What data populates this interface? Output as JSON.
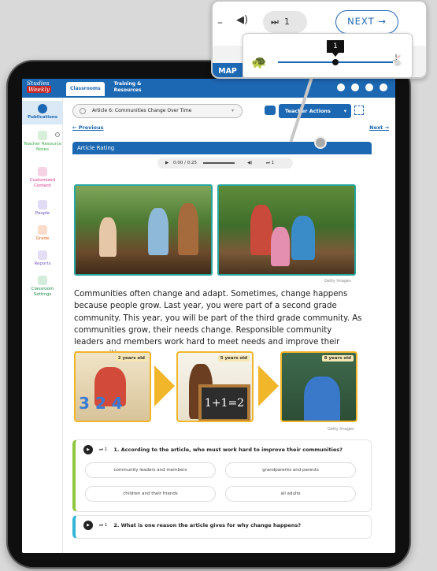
{
  "app": {
    "logo_line1": "Studies",
    "logo_line2": "Weekly",
    "tab_active": "Classrooms",
    "tab_other": "Training & Resources"
  },
  "sidebar": {
    "items": [
      {
        "label": "Publications",
        "color": "#1d68b3"
      },
      {
        "label": "Teacher Resource Notes",
        "color": "#3aa84a"
      },
      {
        "label": "Customized Content",
        "color": "#d6338a"
      },
      {
        "label": "People",
        "color": "#6a4cc3"
      },
      {
        "label": "Grade",
        "color": "#e8631c"
      },
      {
        "label": "Reports",
        "color": "#7a5cc0"
      },
      {
        "label": "Classroom Settings",
        "color": "#1f8a4c"
      }
    ]
  },
  "toolbar": {
    "article_select": "Article 6: Communities Change Over Time",
    "teacher_actions": "Teacher Actions",
    "prev": "Previous",
    "next": "Next"
  },
  "section": {
    "title": "Article Rating"
  },
  "audio": {
    "time": "0:00 / 0:25",
    "speed": "1"
  },
  "credits": {
    "photo": "Getty Images",
    "ages": "Getty Images"
  },
  "article": {
    "paragraph": "Communities often change and adapt. Sometimes, change happens because people grow. Last year, you were part of a second grade community. This year, you will be part of the third grade community. As communities grow, their needs change. Responsible community leaders and members work hard to meet needs and improve their communities."
  },
  "ages": [
    "2 years old",
    "5 years old",
    "8 years old"
  ],
  "questions": [
    {
      "speed": "1",
      "text": "1. According to the article, who must work hard to improve their communities?",
      "answers": [
        "community leaders and members",
        "grandparents and parents",
        "children and their friends",
        "all adults"
      ]
    },
    {
      "speed": "1",
      "text": "2. What is one reason the article gives for why change happens?"
    }
  ],
  "callout": {
    "speed": "1",
    "next": "NEXT →",
    "map": "MAP",
    "slider_label": "1",
    "slider_value_fraction": 0.5
  }
}
